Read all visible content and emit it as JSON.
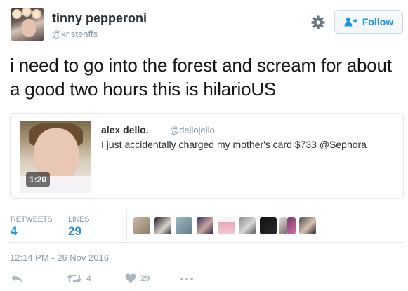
{
  "author": {
    "display_name": "tinny pepperoni",
    "handle": "@kristenffs"
  },
  "header": {
    "gear_icon": "gear-icon",
    "follow_label": "Follow",
    "follow_icon": "follow-person-plus-icon"
  },
  "tweet": {
    "text": "i need to go into the forest and scream for about a good two hours this is hilarioUS"
  },
  "quote": {
    "display_name": "alex dello.",
    "handle": "@dellojello",
    "text": "I just accidentally charged my mother's card $733 @Sephora",
    "media_duration": "1:20"
  },
  "stats": {
    "retweets_label": "RETWEETS",
    "retweets_value": "4",
    "likes_label": "LIKES",
    "likes_value": "29"
  },
  "timestamp": "12:14 PM - 26 Nov 2016",
  "actions": {
    "reply_icon": "reply-icon",
    "retweet_icon": "retweet-icon",
    "retweet_count": "4",
    "like_icon": "heart-icon",
    "like_count": "29",
    "more_icon": "more-dots-icon"
  },
  "colors": {
    "accent": "#1c94e0",
    "muted": "#8899a6",
    "text": "#292f33",
    "border": "#e1e8ed",
    "action_gray": "#aab8c2"
  }
}
